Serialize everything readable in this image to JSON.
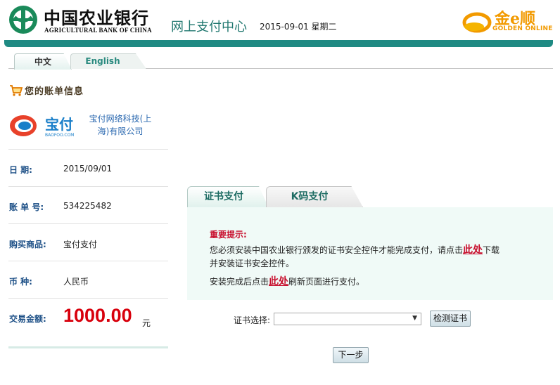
{
  "header": {
    "bank_name_cn": "中国农业银行",
    "bank_name_en": "AGRICULTURAL BANK OF CHINA",
    "center_title": "网上支付中心",
    "date": "2015-09-01 星期二",
    "golden_logo_text": "金e顺",
    "golden_logo_en": "GOLDEN ONLINE",
    "accent_color": "#1f8a83"
  },
  "language_tabs": [
    {
      "label": "中文",
      "active": true
    },
    {
      "label": "English",
      "active": false
    }
  ],
  "bill": {
    "title": "您的账单信息",
    "merchant_name": "宝付网络科技(上海)有限公司",
    "merchant_logo_text": "宝付",
    "merchant_logo_sub": "BAOFOO.COM",
    "rows": [
      {
        "label": "日 期:",
        "value": "2015/09/01"
      },
      {
        "label": "账 单 号:",
        "value": "534225482"
      },
      {
        "label": "购买商品:",
        "value": "宝付支付"
      },
      {
        "label": "币 种:",
        "value": "人民币"
      }
    ],
    "amount_label": "交易金额:",
    "amount": "1000.00",
    "amount_unit": "元"
  },
  "payment_tabs": [
    {
      "label": "证书支付",
      "active": true
    },
    {
      "label": "K码支付",
      "active": false
    }
  ],
  "notice": {
    "title": "重要提示:",
    "line1_before": "您必须安装中国农业银行颁发的证书安全控件才能完成支付，请点击",
    "link1": "此处",
    "line1_after": "下载",
    "line2": "并安装证书安全控件。",
    "line3_before": "安装完成后点击",
    "link2": "此处",
    "line3_after": "刷新页面进行支付。"
  },
  "cert": {
    "label": "证书选择:",
    "selected": "",
    "check_button": "检测证书"
  },
  "next_button": "下一步"
}
